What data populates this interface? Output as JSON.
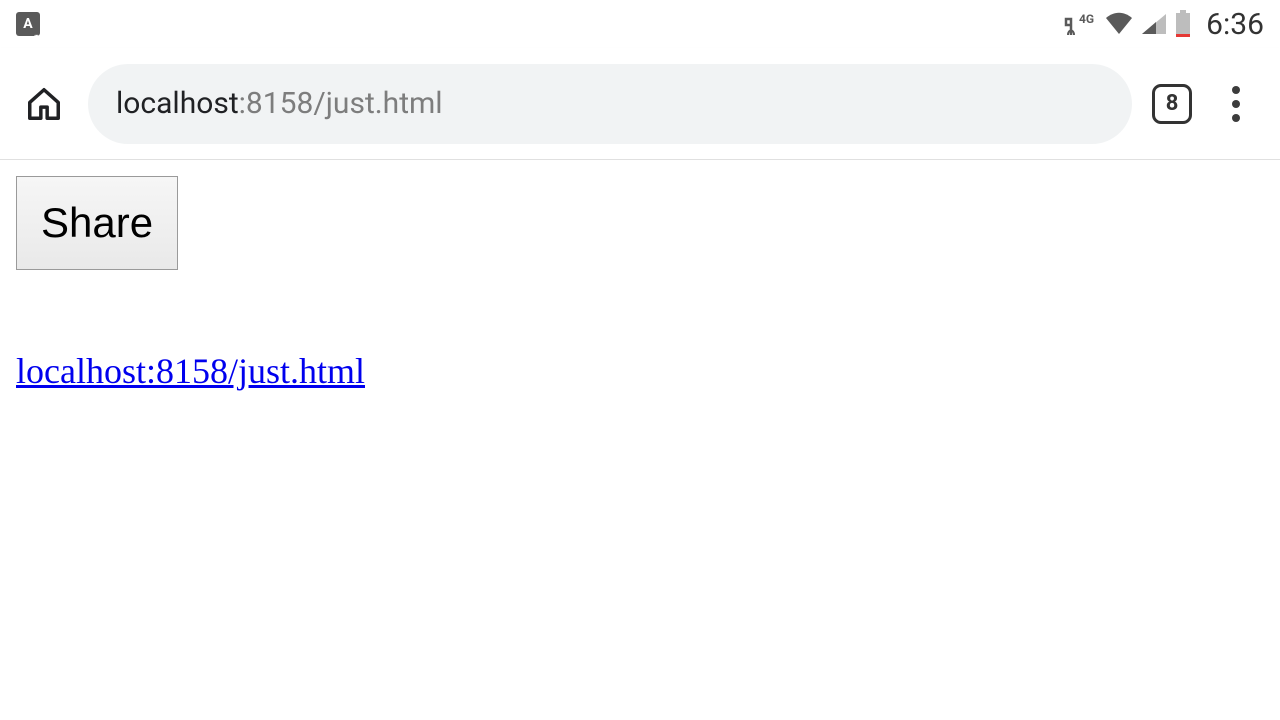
{
  "status": {
    "keyboard_label": "A",
    "network_label": "4G",
    "time": "6:36"
  },
  "chrome": {
    "url_host": "localhost",
    "url_rest": ":8158/just.html",
    "tab_count": "8"
  },
  "page": {
    "share_label": "Share",
    "link_text": "localhost:8158/just.html"
  }
}
